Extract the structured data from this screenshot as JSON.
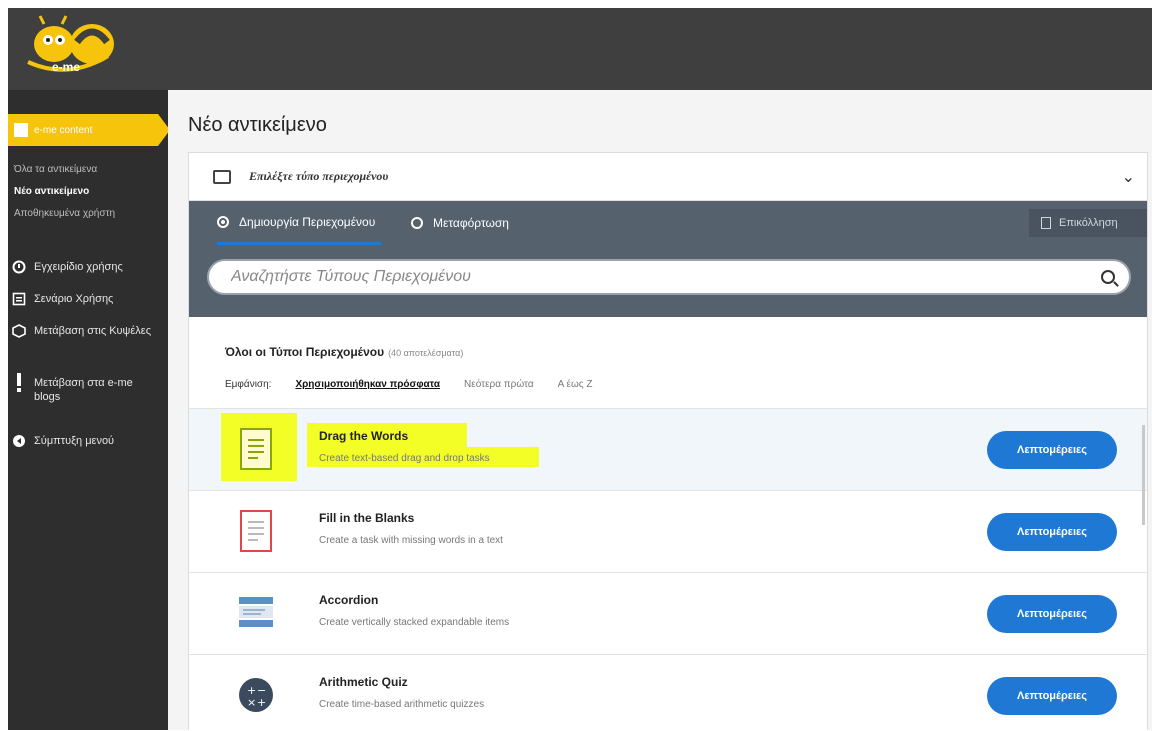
{
  "header": {
    "logo_text": "e-me"
  },
  "sidebar": {
    "active_section": "e-me content",
    "sub_items": [
      {
        "label": "Όλα τα αντικείμενα"
      },
      {
        "label": "Νέο αντικείμενο"
      },
      {
        "label": "Αποθηκευμένα χρήστη"
      }
    ],
    "items": [
      {
        "label": "Εγχειρίδιο χρήσης",
        "icon": "info-circle-icon"
      },
      {
        "label": "Σενάριο Χρήσης",
        "icon": "document-icon"
      },
      {
        "label": "Μετάβαση στις Κυψέλες",
        "icon": "hexagon-icon"
      },
      {
        "label": "Μετάβαση στα e-me blogs",
        "icon": "exclamation-icon"
      },
      {
        "label": "Σύμπτυξη μενού",
        "icon": "collapse-icon"
      }
    ]
  },
  "main": {
    "page_title": "Νέο αντικείμενο",
    "type_selector": {
      "label": "Επιλέξτε τύπο περιεχομένου"
    },
    "tabs": [
      {
        "label": "Δημιουργία Περιεχομένου",
        "selected": true
      },
      {
        "label": "Μεταφόρτωση",
        "selected": false
      }
    ],
    "paste_button": "Επικόλληση",
    "search": {
      "placeholder": "Αναζητήστε Τύπους Περιεχομένου"
    },
    "list_header": {
      "title": "Όλοι οι Τύποι Περιεχομένου",
      "count": "(40 αποτελέσματα)"
    },
    "sort": {
      "label": "Εμφάνιση:",
      "options": [
        "Χρησιμοποιήθηκαν πρόσφατα",
        "Νεότερα πρώτα",
        "Α έως Ζ"
      ]
    },
    "details_button": "Λεπτομέρειες",
    "content_types": [
      {
        "name": "Drag the Words",
        "desc": "Create text-based drag and drop tasks",
        "icon": "drag-words-icon",
        "highlighted": true
      },
      {
        "name": "Fill in the Blanks",
        "desc": "Create a task with missing words in a text",
        "icon": "fill-blanks-icon"
      },
      {
        "name": "Accordion",
        "desc": "Create vertically stacked expandable items",
        "icon": "accordion-icon"
      },
      {
        "name": "Arithmetic Quiz",
        "desc": "Create time-based arithmetic quizzes",
        "icon": "arithmetic-icon"
      }
    ]
  },
  "colors": {
    "accent_yellow": "#f6c40a",
    "primary_blue": "#1e78d4",
    "tab_bar": "#56616e",
    "highlighter": "#f2ff00"
  }
}
